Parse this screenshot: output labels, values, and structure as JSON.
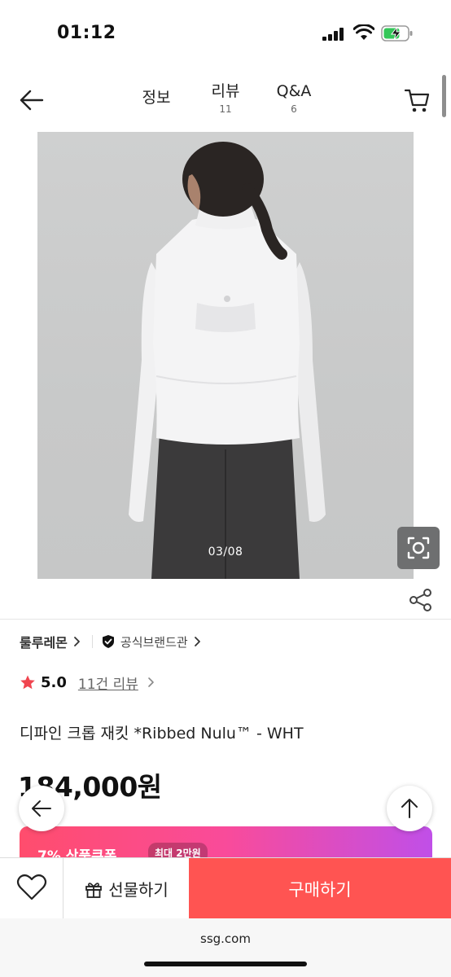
{
  "status": {
    "time": "01:12"
  },
  "nav": {
    "tabs": [
      {
        "label": "정보",
        "count": ""
      },
      {
        "label": "리뷰",
        "count": "11"
      },
      {
        "label": "Q&A",
        "count": "6"
      }
    ],
    "back_icon": "arrow-left-icon",
    "cart_icon": "cart-icon"
  },
  "gallery": {
    "counter": "03/08",
    "current": 3,
    "total": 8
  },
  "brand": {
    "name": "룰루레몬",
    "official_label": "공식브랜드관"
  },
  "rating": {
    "score": "5.0",
    "review_link": "11건 리뷰",
    "star_color": "#f0454f"
  },
  "product": {
    "title": "디파인 크롭 재킷 *Ribbed Nulu™ - WHT",
    "price": "184,000원"
  },
  "coupon": {
    "label": "7% 상품쿠폰",
    "max_label": "최대 2만원"
  },
  "bottom_bar": {
    "gift_label": "선물하기",
    "buy_label": "구매하기",
    "buy_color": "#ff5452"
  },
  "browser": {
    "url": "ssg.com"
  }
}
